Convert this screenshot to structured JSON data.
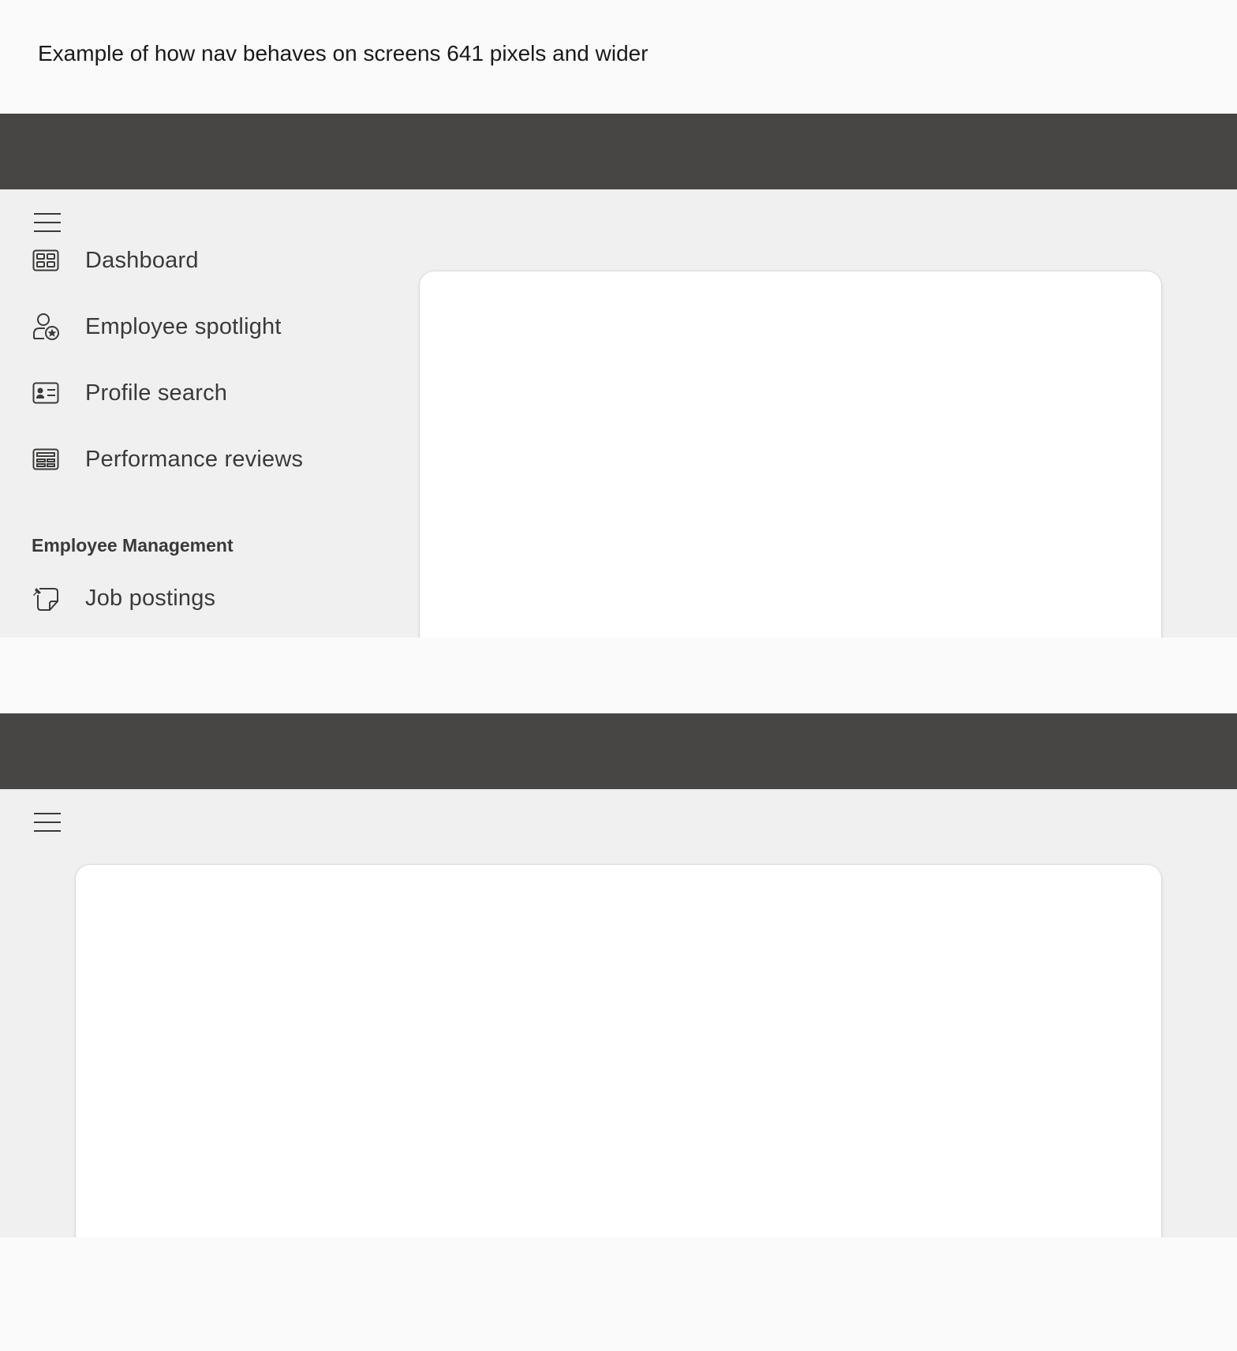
{
  "caption": "Example of how nav behaves on screens 641 pixels and wider",
  "colors": {
    "header_bar": "#484644",
    "workspace": "#f0f0f0",
    "page": "#fafafa",
    "card": "#ffffff"
  },
  "expanded_demo": {
    "hamburger_icon": "hamburger-menu-icon",
    "nav": {
      "items": [
        {
          "label": "Dashboard",
          "icon": "dashboard-icon"
        },
        {
          "label": "Employee spotlight",
          "icon": "person-star-icon"
        },
        {
          "label": "Profile search",
          "icon": "contact-card-icon"
        },
        {
          "label": "Performance reviews",
          "icon": "reviews-table-icon"
        }
      ],
      "section_header": "Employee Management",
      "section_items": [
        {
          "label": "Job postings",
          "icon": "note-pin-icon"
        }
      ]
    }
  },
  "collapsed_demo": {
    "hamburger_icon": "hamburger-menu-icon"
  }
}
